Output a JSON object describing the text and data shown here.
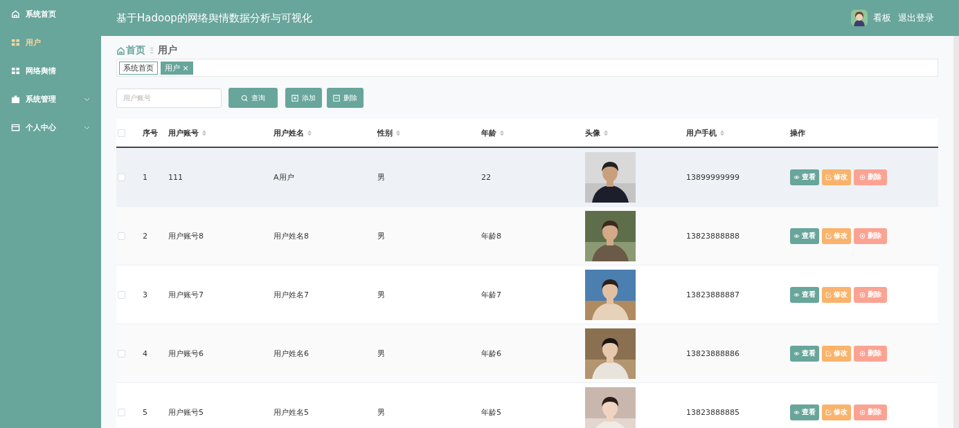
{
  "sidebar": {
    "items": [
      {
        "label": "系统首页",
        "kind": "home",
        "selected": false,
        "expandable": false
      },
      {
        "label": "用户",
        "kind": "grid",
        "selected": true,
        "expandable": false
      },
      {
        "label": "网络舆情",
        "kind": "grid",
        "selected": false,
        "expandable": false
      },
      {
        "label": "系统管理",
        "kind": "briefcase",
        "selected": false,
        "expandable": true
      },
      {
        "label": "个人中心",
        "kind": "card",
        "selected": false,
        "expandable": true
      }
    ]
  },
  "header": {
    "title": "基于Hadoop的网络舆情数据分析与可视化",
    "user_name": "看板",
    "logout": "退出登录"
  },
  "breadcrumb": {
    "home": "首页",
    "separator": "Ξ",
    "current": "用户"
  },
  "tabs": [
    {
      "label": "系统首页",
      "selected": false
    },
    {
      "label": "用户",
      "selected": true,
      "close": "×"
    }
  ],
  "search": {
    "placeholder": "用户账号",
    "buttons": [
      {
        "label": "查询",
        "kind": "search"
      },
      {
        "label": "添加",
        "kind": "add"
      },
      {
        "label": "删除",
        "kind": "remove"
      }
    ]
  },
  "table": {
    "select_all_checked": false,
    "columns": [
      {
        "label": "序号",
        "sortable": false
      },
      {
        "label": "用户账号",
        "sortable": true
      },
      {
        "label": "用户姓名",
        "sortable": true
      },
      {
        "label": "性别",
        "sortable": true
      },
      {
        "label": "年龄",
        "sortable": true
      },
      {
        "label": "头像",
        "sortable": true
      },
      {
        "label": "用户手机",
        "sortable": true
      },
      {
        "label": "操作",
        "sortable": false
      }
    ],
    "rows": [
      {
        "index": "1",
        "account": "111",
        "name": "A用户",
        "gender": "男",
        "age": "22",
        "phone": "13899999999",
        "checked": false,
        "hovered": true,
        "actions": [
          {
            "label": "查看",
            "kind": "view"
          },
          {
            "label": "修改",
            "kind": "edit"
          },
          {
            "label": "删除",
            "kind": "delete"
          }
        ]
      },
      {
        "index": "2",
        "account": "用户账号8",
        "name": "用户姓名8",
        "gender": "男",
        "age": "年龄8",
        "phone": "13823888888",
        "checked": false,
        "hovered": false,
        "actions": [
          {
            "label": "查看",
            "kind": "view"
          },
          {
            "label": "修改",
            "kind": "edit"
          },
          {
            "label": "删除",
            "kind": "delete"
          }
        ]
      },
      {
        "index": "3",
        "account": "用户账号7",
        "name": "用户姓名7",
        "gender": "男",
        "age": "年龄7",
        "phone": "13823888887",
        "checked": false,
        "hovered": false,
        "actions": [
          {
            "label": "查看",
            "kind": "view"
          },
          {
            "label": "修改",
            "kind": "edit"
          },
          {
            "label": "删除",
            "kind": "delete"
          }
        ]
      },
      {
        "index": "4",
        "account": "用户账号6",
        "name": "用户姓名6",
        "gender": "男",
        "age": "年龄6",
        "phone": "13823888886",
        "checked": false,
        "hovered": false,
        "actions": [
          {
            "label": "查看",
            "kind": "view"
          },
          {
            "label": "修改",
            "kind": "edit"
          },
          {
            "label": "删除",
            "kind": "delete"
          }
        ]
      },
      {
        "index": "5",
        "account": "用户账号5",
        "name": "用户姓名5",
        "gender": "男",
        "age": "年龄5",
        "phone": "13823888885",
        "checked": false,
        "hovered": false,
        "actions": [
          {
            "label": "查看",
            "kind": "view"
          },
          {
            "label": "修改",
            "kind": "edit"
          },
          {
            "label": "删除",
            "kind": "delete"
          }
        ]
      }
    ]
  }
}
